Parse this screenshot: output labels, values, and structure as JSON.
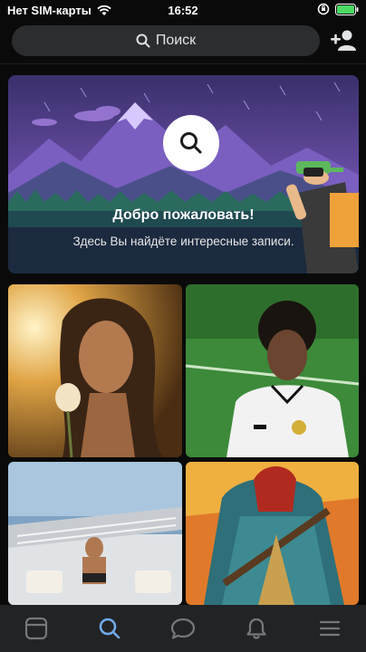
{
  "status_bar": {
    "carrier": "Нет SIM-карты",
    "time": "16:52"
  },
  "search": {
    "label": "Поиск"
  },
  "banner": {
    "title": "Добро пожаловать!",
    "subtitle": "Здесь Вы найдёте интересные записи."
  },
  "tabs": [
    {
      "name": "feed",
      "icon": "newsfeed-icon",
      "active": false
    },
    {
      "name": "search",
      "icon": "search-icon",
      "active": true
    },
    {
      "name": "messages",
      "icon": "chat-icon",
      "active": false
    },
    {
      "name": "notifications",
      "icon": "bell-icon",
      "active": false
    },
    {
      "name": "menu",
      "icon": "menu-icon",
      "active": false
    }
  ],
  "colors": {
    "accent": "#71aaeb",
    "inactive": "#76787a",
    "tabbar": "#222325",
    "searchbar": "#2c2d2f"
  }
}
